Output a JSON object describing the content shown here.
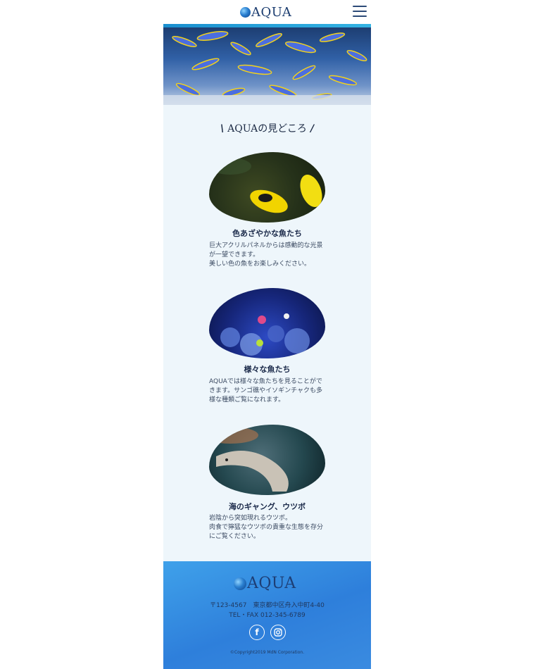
{
  "header": {
    "logo_text": "AQUA",
    "menu_icon": "hamburger-icon"
  },
  "section": {
    "title": "AQUAの見どころ"
  },
  "cards": [
    {
      "title": "色あざやかな魚たち",
      "desc_lines": [
        "巨大アクリルパネルからは感動的な光景",
        "が一望できます。",
        "美しい色の魚をお楽しみください。"
      ]
    },
    {
      "title": "様々な魚たち",
      "desc_lines": [
        "AQUAでは様々な魚たちを見ることがで",
        "きます。サンゴ礁やイソギンチャクも多",
        "様な種類ご覧になれます。"
      ]
    },
    {
      "title": "海のギャング、ウツボ",
      "desc_lines": [
        "岩陰から突如現れるウツボ。",
        "肉食で獰猛なウツボの貴重な生態を存分",
        "にご覧ください。"
      ]
    }
  ],
  "footer": {
    "logo_text": "AQUA",
    "address": "〒123-4567　東京都中区舟入中町4-40",
    "tel": "TEL・FAX 012-345-6789",
    "social": [
      "facebook-icon",
      "instagram-icon"
    ],
    "copyright": "©Copyright2019 MdN Corporation."
  },
  "colors": {
    "accent": "#1a8fcf",
    "footer_bg": "#3a8be0",
    "page_bg": "#eef6fb",
    "logo_text": "#1c3d70"
  }
}
